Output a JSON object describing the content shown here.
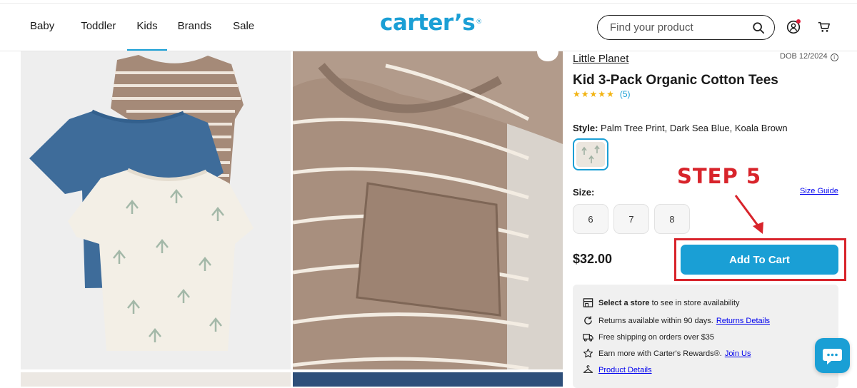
{
  "nav": {
    "items": [
      {
        "label": "Baby",
        "active": false
      },
      {
        "label": "Toddler",
        "active": false
      },
      {
        "label": "Kids",
        "active": true
      },
      {
        "label": "Brands",
        "active": false
      },
      {
        "label": "Sale",
        "active": false
      }
    ],
    "accent_color": "#1a9fd5"
  },
  "logo": {
    "text": "carter’s",
    "mark": "®"
  },
  "search": {
    "placeholder": "Find your product",
    "icon": "search-icon"
  },
  "header_icons": [
    "account-icon",
    "cart-icon"
  ],
  "product": {
    "brand": "Little Planet",
    "dob": "DOB 12/2024",
    "title": "Kid 3-Pack Organic Cotton Tees",
    "rating": {
      "stars": 5,
      "count": "(5)"
    },
    "style_label": "Style:",
    "style_value": "Palm Tree Print, Dark Sea Blue, Koala Brown",
    "size_label": "Size:",
    "size_guide": "Size Guide",
    "sizes": [
      "6",
      "7",
      "8"
    ],
    "price": "$32.00",
    "add_to_cart": "Add To Cart"
  },
  "annotation": {
    "step_text": "STEP 5",
    "color": "#d8242b"
  },
  "info": {
    "store": {
      "bold": "Select a store",
      "text": "to see in store availability"
    },
    "returns": {
      "text": "Returns available within 90 days.",
      "link": "Returns Details"
    },
    "shipping": {
      "text": "Free shipping on orders over $35"
    },
    "rewards": {
      "text": "Earn more with Carter's Rewards®.",
      "link": "Join Us"
    },
    "details": {
      "link": "Product Details"
    }
  }
}
